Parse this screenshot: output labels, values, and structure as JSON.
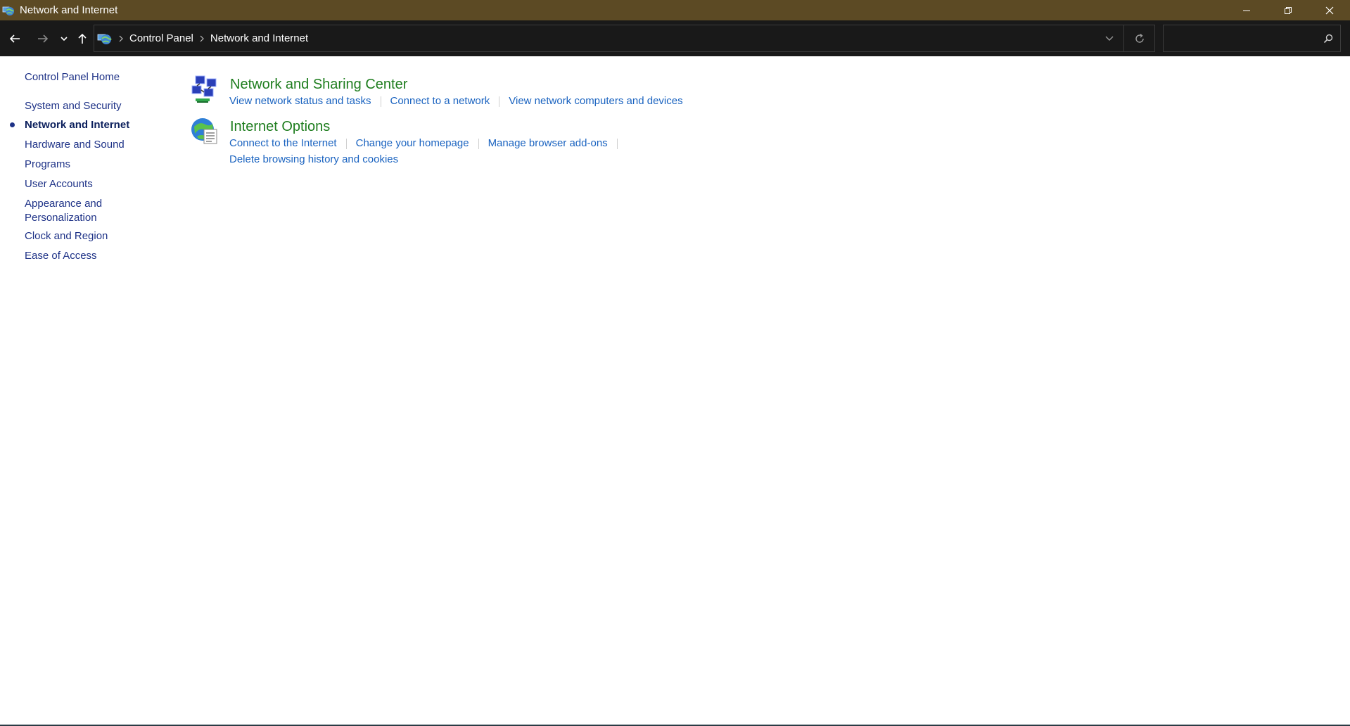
{
  "window": {
    "title": "Network and Internet",
    "title_icon": "network-globe-icon",
    "controls": [
      "minimize-icon",
      "restore-icon",
      "close-icon"
    ]
  },
  "navbar": {
    "back_icon": "arrow-left-icon",
    "forward_icon": "arrow-right-icon",
    "recent_icon": "chevron-down-icon",
    "up_icon": "arrow-up-icon",
    "breadcrumbs": [
      {
        "label": "Control Panel"
      },
      {
        "label": "Network and Internet"
      }
    ],
    "search": {
      "value": "",
      "placeholder": ""
    }
  },
  "sidebar": {
    "home": "Control Panel Home",
    "items": [
      {
        "label": "System and Security",
        "current": false
      },
      {
        "label": "Network and Internet",
        "current": true
      },
      {
        "label": "Hardware and Sound",
        "current": false
      },
      {
        "label": "Programs",
        "current": false
      },
      {
        "label": "User Accounts",
        "current": false
      },
      {
        "label": "Appearance and Personalization",
        "line1": "Appearance and",
        "line2": "Personalization",
        "current": false
      },
      {
        "label": "Clock and Region",
        "current": false
      },
      {
        "label": "Ease of Access",
        "current": false
      }
    ]
  },
  "categories": [
    {
      "title": "Network and Sharing Center",
      "icon": "network-sharing-icon",
      "tasks": [
        "View network status and tasks",
        "Connect to a network",
        "View network computers and devices"
      ]
    },
    {
      "title": "Internet Options",
      "icon": "internet-options-icon",
      "tasks": [
        "Connect to the Internet",
        "Change your homepage",
        "Manage browser add-ons",
        "Delete browsing history and cookies"
      ]
    }
  ],
  "colors": {
    "titlebar": "#5c4a24",
    "navbar": "#191919",
    "category_title": "#1e7d1e",
    "task_link": "#1a63c0",
    "sidebar_link": "#1e3287"
  }
}
